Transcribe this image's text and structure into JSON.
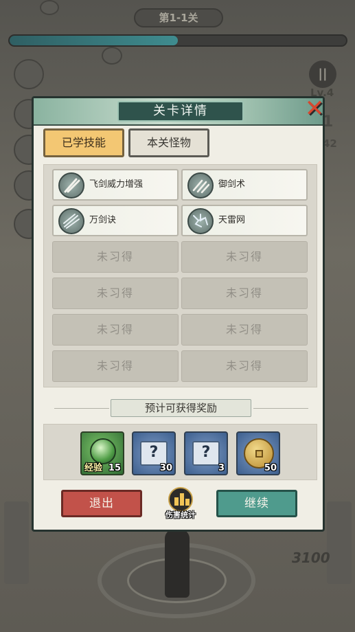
{
  "hud": {
    "stage_label": "第1-1关",
    "stage_progress_fraction": 0.5,
    "pause_icon": "pause-icon",
    "level_label": "Lv.4",
    "side_value_1": "1",
    "side_value_2": "42",
    "score": "3100"
  },
  "modal": {
    "title": "关卡详情",
    "close_icon": "close-x-icon",
    "tabs": [
      {
        "label": "已学技能",
        "active": true
      },
      {
        "label": "本关怪物",
        "active": false
      }
    ],
    "skills": [
      {
        "name": "飞剑威力增强",
        "icon": "flying-sword-icon"
      },
      {
        "name": "御剑术",
        "icon": "sword-control-icon"
      },
      {
        "name": "万剑诀",
        "icon": "myriad-swords-icon"
      },
      {
        "name": "天雷网",
        "icon": "thunder-net-icon"
      }
    ],
    "empty_slot_label": "未习得",
    "reward_title": "预计可获得奖励",
    "rewards": [
      {
        "label": "经验",
        "count": "15",
        "icon": "exp-orb-icon"
      },
      {
        "count": "30",
        "icon": "mystery-scroll-icon"
      },
      {
        "count": "3",
        "icon": "mystery-scroll-icon"
      },
      {
        "count": "50",
        "icon": "copper-coin-icon"
      }
    ],
    "buttons": {
      "exit": "退出",
      "damage_stats": "伤害统计",
      "continue": "继续"
    }
  },
  "colors": {
    "exit_button": "#c2524a",
    "continue_button": "#4f9b8d",
    "active_tab": "#f3c773"
  }
}
